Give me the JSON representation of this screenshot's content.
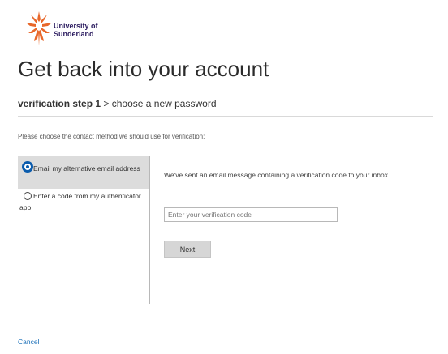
{
  "header": {
    "logo_line1": "University of",
    "logo_line2": "Sunderland",
    "logo_icon": "sunderland-crest-icon",
    "brand_colors": {
      "crest": "#e8672a",
      "text": "#2a1a5e"
    }
  },
  "page": {
    "title": "Get back into your account"
  },
  "steps": {
    "current": "verification step 1",
    "separator": ">",
    "next": "choose a new password"
  },
  "instruction": "Please choose the contact method we should use for verification:",
  "methods": [
    {
      "label": "Email my alternative email address",
      "selected": true
    },
    {
      "label": "Enter a code from my authenticator app",
      "selected": false
    }
  ],
  "verification": {
    "message": "We've sent an email message containing a verification code to your inbox.",
    "code_placeholder": "Enter your verification code",
    "code_value": "",
    "next_label": "Next"
  },
  "footer": {
    "cancel_label": "Cancel"
  },
  "colors": {
    "selected_radio": "#0b5cad",
    "link": "#1a6fb8",
    "selected_bg": "#dcdcdc"
  }
}
